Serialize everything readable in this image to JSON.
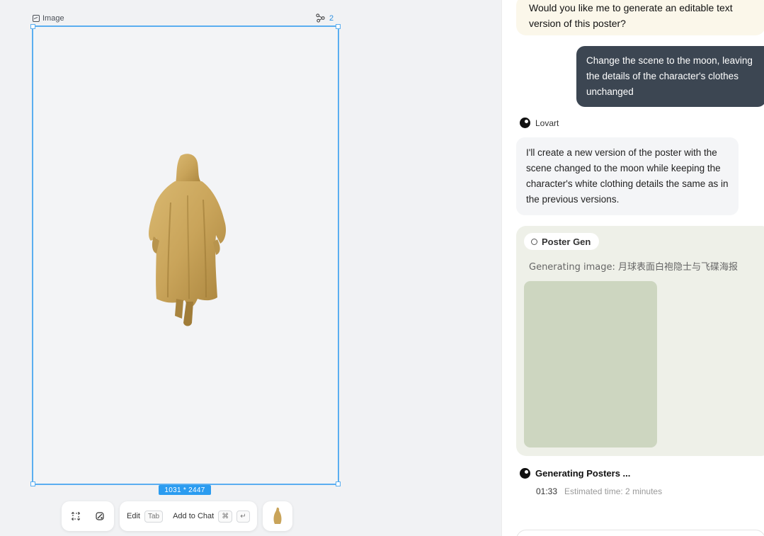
{
  "canvas": {
    "frame_label": "Image",
    "link_count": "2",
    "dimensions": "1031 * 2447",
    "toolbar": {
      "edit_label": "Edit",
      "edit_key": "Tab",
      "add_to_chat_label": "Add to Chat",
      "add_to_chat_key1": "⌘",
      "add_to_chat_key2": "↵"
    }
  },
  "chat": {
    "prev_assistant_text": "Would you like me to generate an editable text version of this poster?",
    "user_message": "Change the scene to the moon, leaving the details of the character's clothes unchanged",
    "bot_name": "Lovart",
    "bot_reply": "I'll create a new version of the poster with the scene changed to the moon while keeping the character's white clothing details the same as in the previous versions.",
    "tool_pill": "Poster Gen",
    "generating_text": "Generating image: 月球表面白袍隐士与飞碟海报",
    "status_title": "Generating Posters ...",
    "timer": "01:33",
    "estimated": "Estimated time: 2 minutes"
  },
  "colors": {
    "selection": "#5aaef0",
    "user_bubble": "#3c4652",
    "placeholder": "#cdd6c0",
    "robe": "#c9a45a"
  }
}
